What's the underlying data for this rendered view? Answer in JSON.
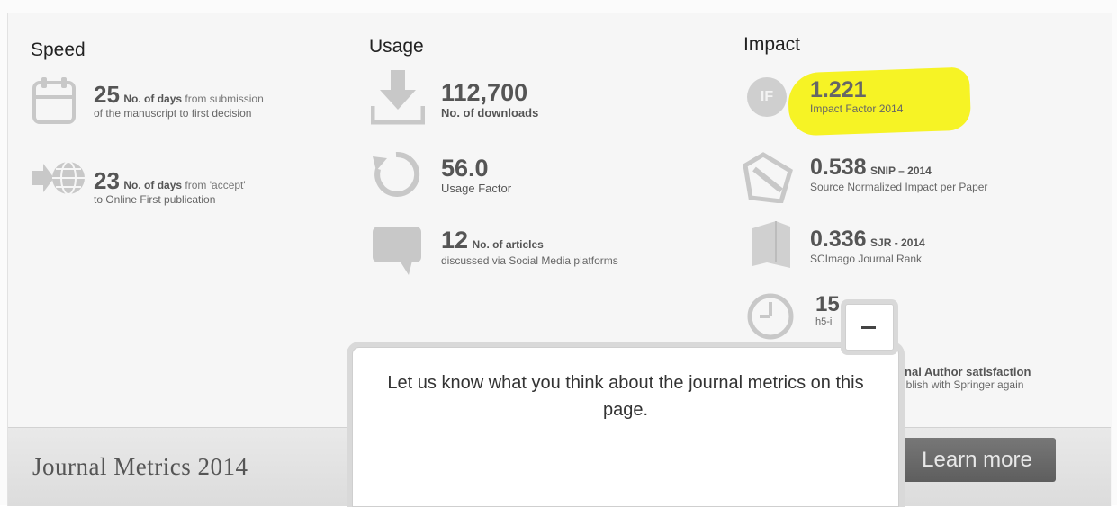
{
  "speed": {
    "title": "Speed",
    "m1": {
      "value": "25",
      "label_a": "No. of days",
      "label_b": " from submission",
      "label_c": "of the manuscript to first decision"
    },
    "m2": {
      "value": "23",
      "label_a": "No. of days",
      "label_b": " from 'accept'",
      "label_c": "to Online First publication"
    }
  },
  "usage": {
    "title": "Usage",
    "downloads": {
      "value": "112,700",
      "label": "No. of downloads"
    },
    "factor": {
      "value": "56.0",
      "label": "Usage Factor"
    },
    "articles": {
      "value": "12",
      "label_a": "No. of articles",
      "label_b": "discussed via Social Media platforms"
    }
  },
  "impact": {
    "title": "Impact",
    "if_badge": "IF",
    "impact_factor": {
      "value": "1.221",
      "label": "Impact Factor 2014"
    },
    "snip": {
      "value": "0.538",
      "tag": "SNIP – 2014",
      "label": "Source Normalized Impact per Paper"
    },
    "sjr": {
      "value": "0.336",
      "tag": "SJR - 2014",
      "label": "SCImago Journal Rank"
    },
    "h5": {
      "value": "15",
      "label": "h5-i"
    },
    "satisfaction": {
      "label_a": "rnal Author satisfaction",
      "label_b": "ublish with Springer again"
    }
  },
  "footer": {
    "title": "Journal Metrics 2014",
    "learn_more": "Learn more"
  },
  "popup": {
    "text": "Let us know what you think about the journal metrics on this page.",
    "collapse": "–"
  },
  "colors": {
    "highlight": "#f6f200",
    "button": "#666666"
  }
}
